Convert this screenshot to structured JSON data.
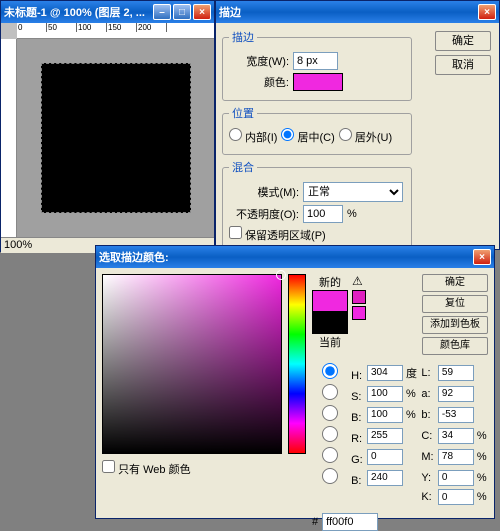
{
  "doc": {
    "title": "未标题-1 @ 100% (图层 2, ...",
    "zoom": "100%",
    "ruler_marks": [
      "0",
      "50",
      "100",
      "150",
      "200"
    ]
  },
  "stroke": {
    "title": "描边",
    "ok": "确定",
    "cancel": "取消",
    "group_stroke": "描边",
    "width_label": "宽度(W):",
    "width_value": "8 px",
    "color_label": "颜色:",
    "group_pos": "位置",
    "pos_inside": "内部(I)",
    "pos_center": "居中(C)",
    "pos_outside": "居外(U)",
    "group_blend": "混合",
    "mode_label": "模式(M):",
    "mode_value": "正常",
    "opacity_label": "不透明度(O):",
    "opacity_value": "100",
    "opacity_unit": "%",
    "preserve": "保留透明区域(P)"
  },
  "picker": {
    "title": "选取描边颜色:",
    "new_label": "新的",
    "current_label": "当前",
    "ok": "确定",
    "reset": "复位",
    "add_swatch": "添加到色板",
    "color_lib": "颜色库",
    "web_only": "只有 Web 颜色",
    "H": "304",
    "H_unit": "度",
    "S": "100",
    "S_unit": "%",
    "Bv": "100",
    "B_unit": "%",
    "R": "255",
    "G": "0",
    "Bl": "240",
    "L": "59",
    "a": "92",
    "b": "-53",
    "C": "34",
    "C_unit": "%",
    "M": "78",
    "M_unit": "%",
    "Y": "0",
    "Y_unit": "%",
    "K": "0",
    "K_unit": "%",
    "hex_label": "#",
    "hex": "ff00f0",
    "labels": {
      "H": "H:",
      "S": "S:",
      "B": "B:",
      "R": "R:",
      "G": "G:",
      "Bl": "B:",
      "L": "L:",
      "a": "a:",
      "b": "b:",
      "C": "C:",
      "M": "M:",
      "Y": "Y:",
      "K": "K:"
    }
  }
}
